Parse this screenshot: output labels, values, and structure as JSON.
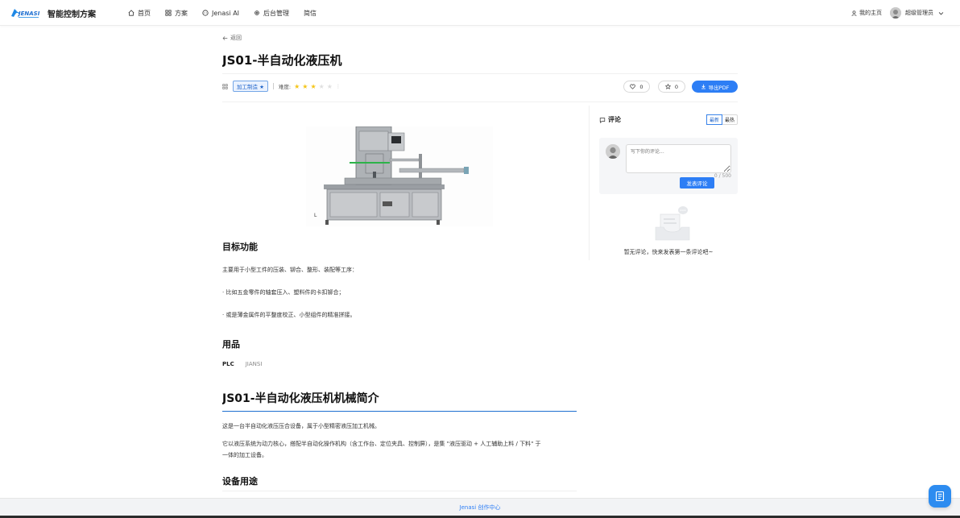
{
  "header": {
    "logo_text": "JENASI",
    "app_title": "智能控制方案",
    "nav": [
      {
        "label": "首页",
        "icon": "home-icon"
      },
      {
        "label": "方案",
        "icon": "grid-icon"
      },
      {
        "label": "Jenasi AI",
        "icon": "ai-icon"
      },
      {
        "label": "后台管理",
        "icon": "gear-icon"
      },
      {
        "label": "简信",
        "icon": ""
      }
    ],
    "my_home": "我的主页",
    "username": "超级管理员"
  },
  "page": {
    "back_label": "返回",
    "title": "JS01-半自动化液压机",
    "category_tag": "加工制造",
    "difficulty_label": "难度:",
    "difficulty_stars": 3,
    "difficulty_max": 5,
    "like_count": "0",
    "fav_count": "0",
    "export_label": "导出PDF"
  },
  "article": {
    "section1_title": "目标功能",
    "section1_lines": [
      "主要用于小型工件的压装、铆合、整形、装配等工序：",
      "· 比如五金零件的轴套压入、塑料件的卡扣铆合；",
      "· 或是薄金属件的平整度校正、小型组件的精准拼接。"
    ],
    "section2_title": "用品",
    "tools": [
      "PLC",
      "JIANSI"
    ],
    "intro_title": "JS01-半自动化液压机机械简介",
    "intro_p1": "这是一台半自动化液压压合设备，属于小型精密液压加工机械。",
    "intro_p2_line1": "它以液压系统为动力核心，搭配半自动化操作机构（含工作台、定位夹具、控制屏），是集 \"液压驱动 + 人工辅助上料 / 下料\" 于",
    "intro_p2_line2": "一体的加工设备。",
    "section3_title": "设备用途"
  },
  "comments": {
    "title": "评论",
    "sort_latest": "最新",
    "sort_hot": "最热",
    "placeholder": "写下你的评论...",
    "counter": "0 / 500",
    "submit_label": "发表评论",
    "empty_text": "暂无评论，快来发表第一条评论吧~"
  },
  "footer": {
    "text": "Jenasi 创作中心"
  },
  "colors": {
    "accent": "#2d7ef5",
    "star_on": "#f5c518",
    "star_off": "#e0e0e0"
  }
}
